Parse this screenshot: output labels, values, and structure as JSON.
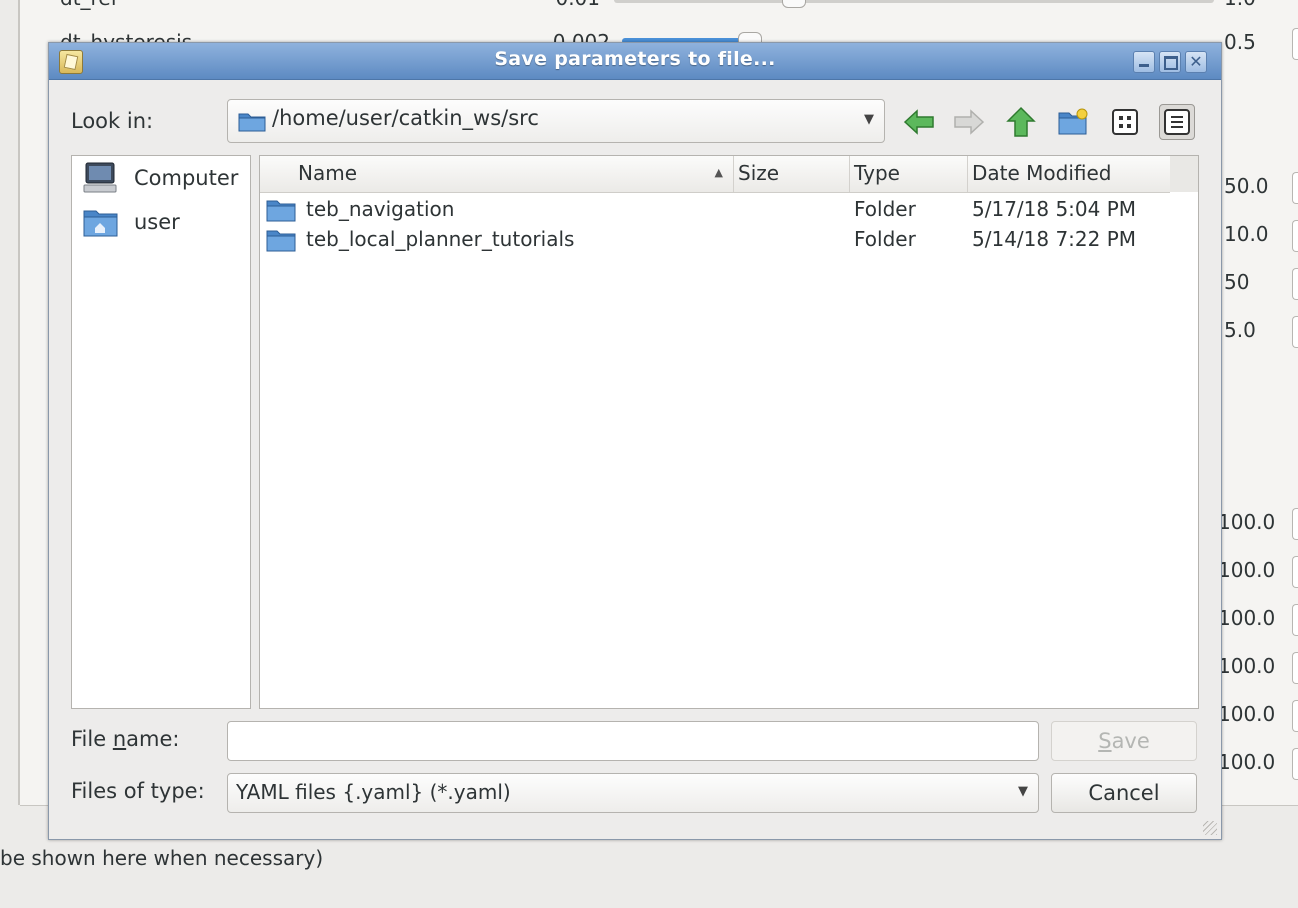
{
  "background": {
    "params": [
      {
        "label": "dt_ref",
        "value": "0.01",
        "max": "1.0"
      },
      {
        "label": "dt_hysteresis",
        "value": "0.002",
        "max": "0.5"
      }
    ],
    "right_values": [
      "50.0",
      "10.0",
      "50",
      "5.0",
      "100.0",
      "100.0",
      "100.0",
      "100.0",
      "100.0",
      "100.0"
    ],
    "status_text": "be shown here when necessary)"
  },
  "dialog": {
    "title": "Save parameters to file...",
    "look_in_label": "Look in:",
    "path": "/home/user/catkin_ws/src",
    "toolbar_icons": [
      "back-arrow-icon",
      "forward-arrow-icon",
      "up-arrow-icon",
      "new-folder-icon",
      "list-view-icon",
      "detail-view-icon"
    ],
    "sidebar": [
      {
        "label": "Computer",
        "icon": "computer-icon"
      },
      {
        "label": "user",
        "icon": "home-folder-icon"
      }
    ],
    "columns": [
      "Name",
      "Size",
      "Type",
      "Date Modified"
    ],
    "files": [
      {
        "name": "teb_navigation",
        "size": "",
        "type": "Folder",
        "modified": "5/17/18 5:04 PM"
      },
      {
        "name": "teb_local_planner_tutorials",
        "size": "",
        "type": "Folder",
        "modified": "5/14/18 7:22 PM"
      }
    ],
    "file_name_label_pre": "File ",
    "file_name_label_u": "n",
    "file_name_label_post": "ame:",
    "file_name_value": "",
    "files_of_type_label": "Files of type:",
    "file_type": "YAML files {.yaml} (*.yaml)",
    "save_label_u": "S",
    "save_label_rest": "ave",
    "cancel_label": "Cancel"
  },
  "colors": {
    "accent": "#5d8ac2",
    "folder": "#4a86c8",
    "nav_green": "#4caf50"
  }
}
